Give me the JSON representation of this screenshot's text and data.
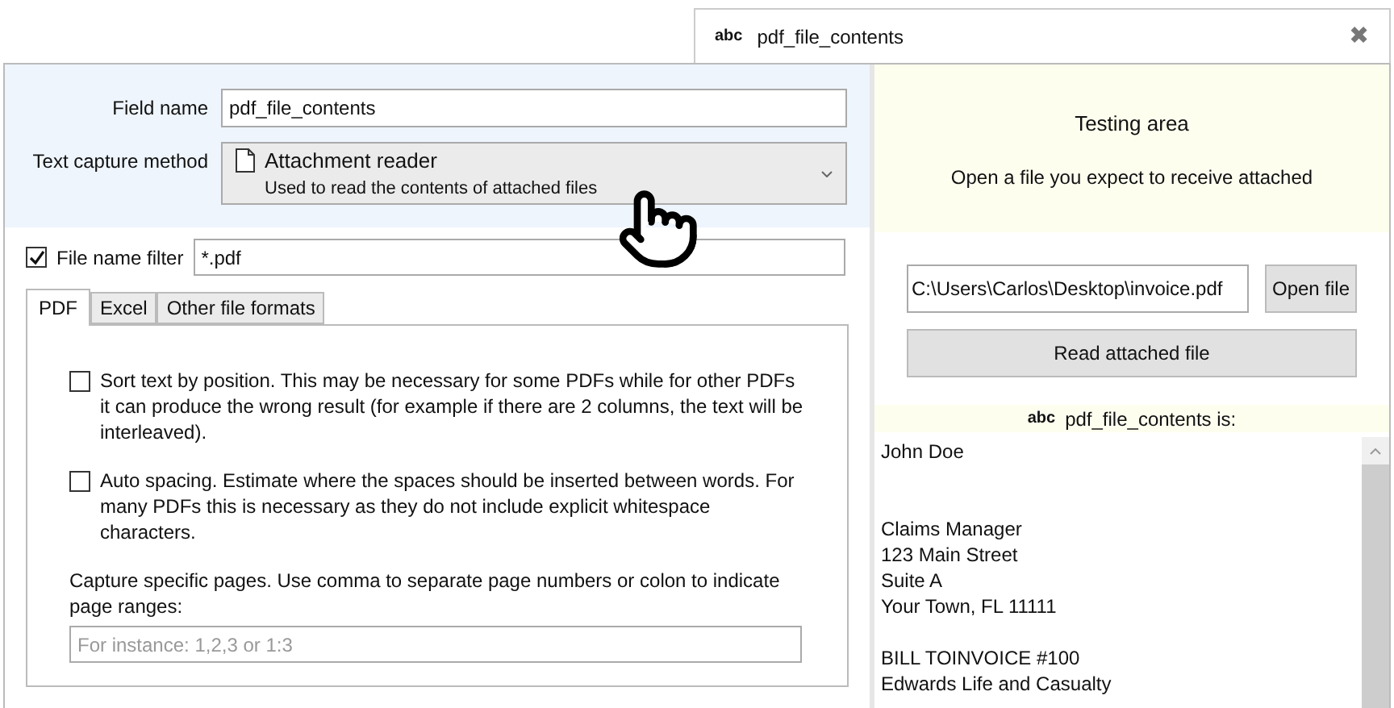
{
  "tab": {
    "icon_text": "abc",
    "title": "pdf_file_contents",
    "close": "✖"
  },
  "settings": {
    "field_name": {
      "label": "Field name",
      "value": "pdf_file_contents"
    },
    "capture_method": {
      "label": "Text capture method",
      "title": "Attachment reader",
      "description": "Used to read the contents of attached files"
    },
    "file_filter": {
      "label": "File name filter",
      "checked": true,
      "value": "*.pdf"
    },
    "format_tabs": [
      {
        "label": "PDF",
        "selected": true
      },
      {
        "label": "Excel",
        "selected": false
      },
      {
        "label": "Other file formats",
        "selected": false
      }
    ],
    "options": [
      {
        "text": "Sort text by position. This may be necessary for some PDFs while for other PDFs it can produce the wrong result (for example if there are 2 columns, the text will be interleaved).",
        "checked": false
      },
      {
        "text": "Auto spacing. Estimate where the spaces should be inserted between words. For many PDFs this is necessary as they do not include explicit whitespace characters.",
        "checked": false
      }
    ],
    "pages": {
      "label": "Capture specific pages. Use comma to separate page numbers or colon to indicate page ranges:",
      "placeholder": "For instance: 1,2,3 or 1:3"
    }
  },
  "testing": {
    "title": "Testing area",
    "subtitle": "Open a file you expect to receive attached",
    "file_path": "C:\\Users\\Carlos\\Desktop\\invoice.pdf",
    "open_button": "Open file",
    "read_button": "Read attached file",
    "result_icon_text": "abc",
    "result_label": "pdf_file_contents is:",
    "result_blocks": [
      [
        "John Doe"
      ],
      [
        "Claims Manager",
        "123 Main Street",
        "Suite A",
        "Your Town, FL 11111"
      ],
      [
        "BILL TOINVOICE #100",
        "Edwards Life and Casualty"
      ]
    ]
  }
}
